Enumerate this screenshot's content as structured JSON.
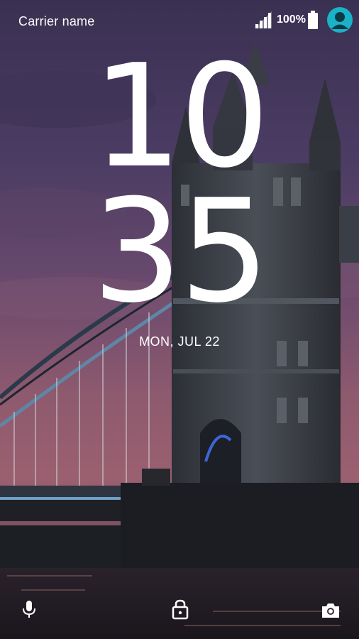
{
  "status_bar": {
    "carrier": "Carrier name",
    "battery_percent": "100%",
    "signal_level": 4,
    "battery_level": 1.0
  },
  "clock": {
    "hours": "10",
    "minutes": "35",
    "date": "MON, JUL 22"
  },
  "bottom_bar": {
    "left_icon": "microphone-icon",
    "center_icon": "lock-icon",
    "right_icon": "camera-icon"
  },
  "colors": {
    "accent": "#1ab2c9",
    "text": "#ffffff"
  }
}
